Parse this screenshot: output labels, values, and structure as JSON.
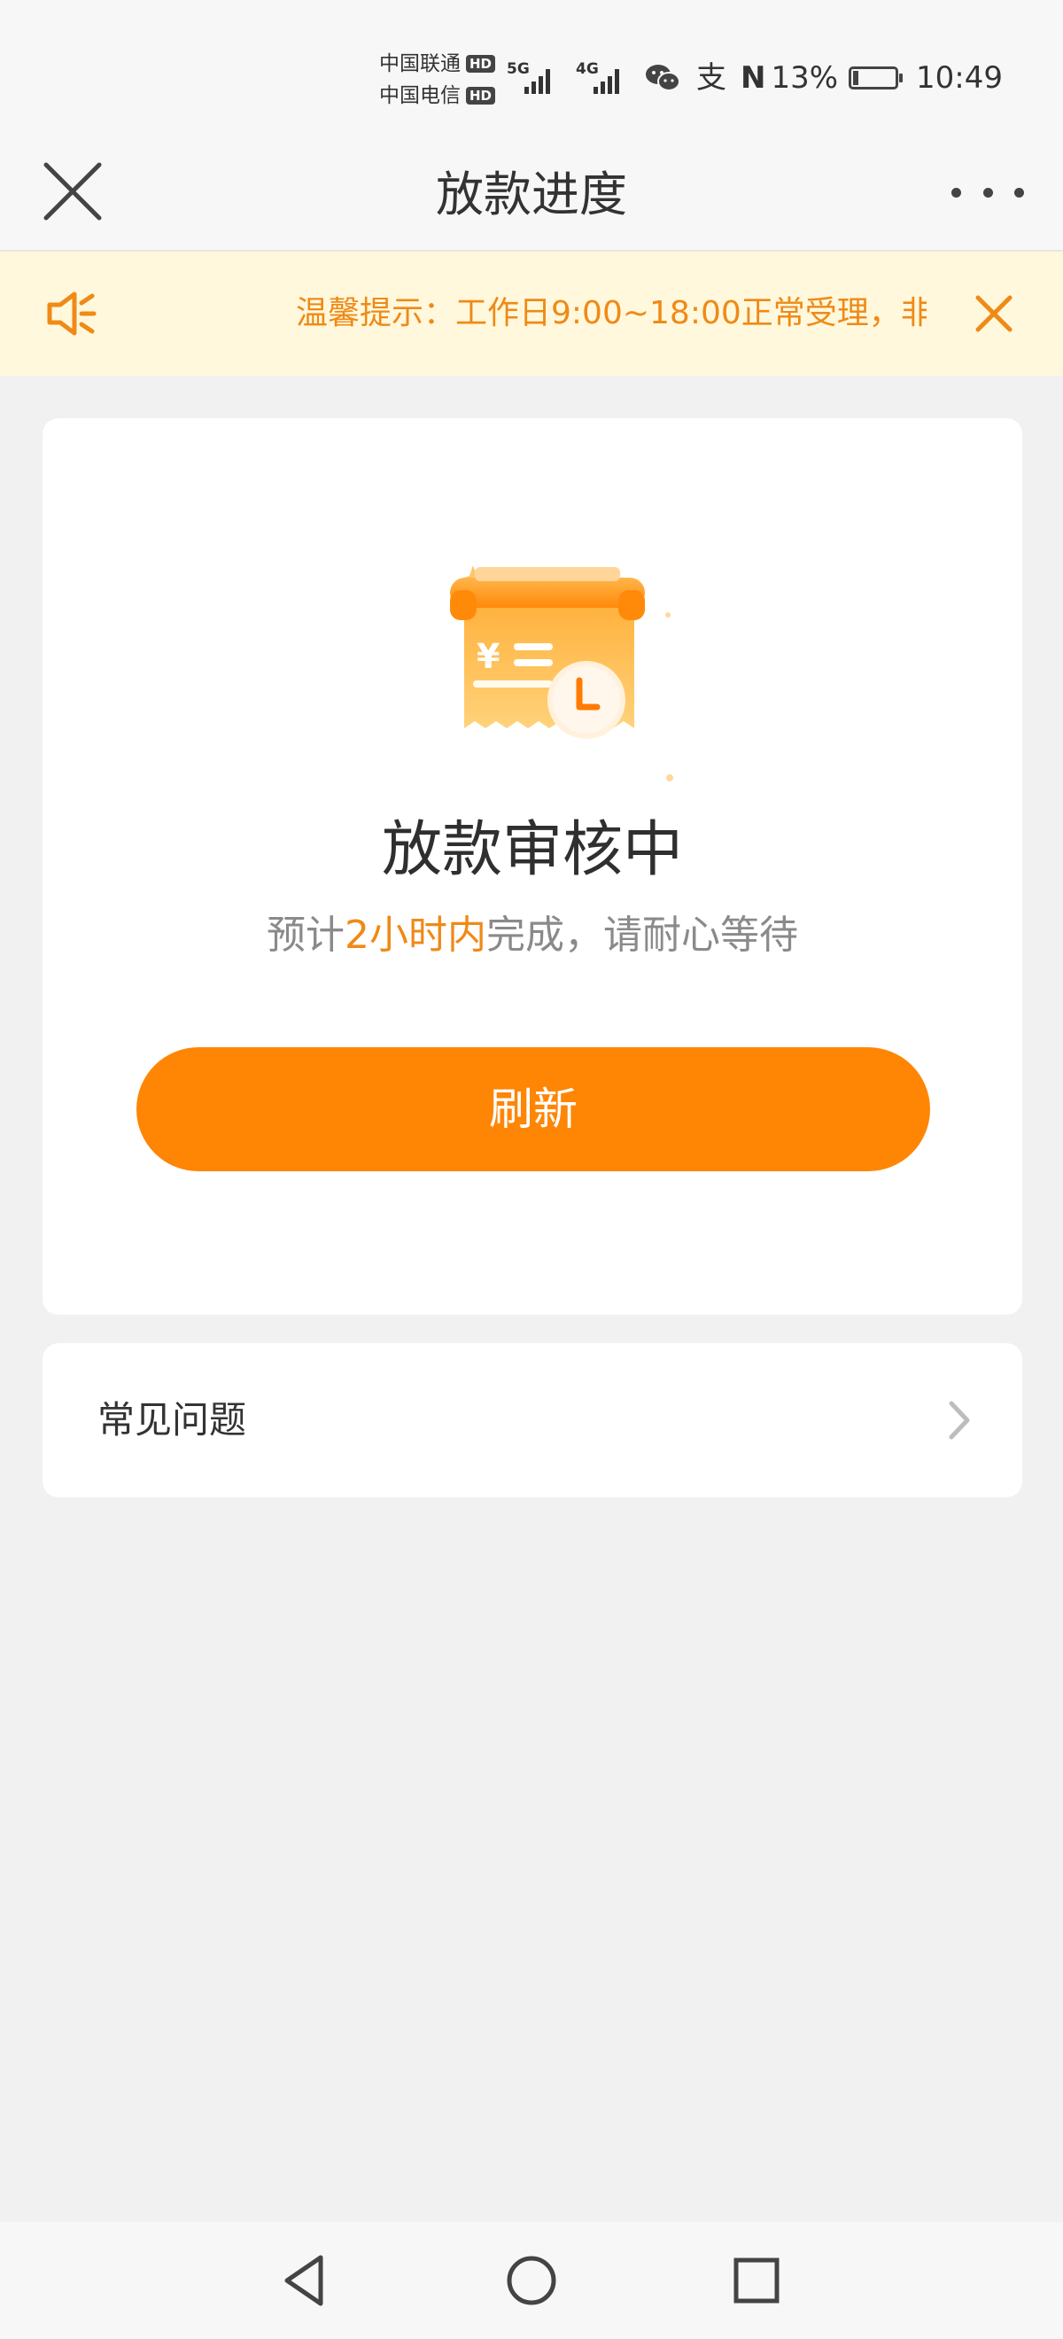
{
  "status_bar": {
    "carriers": [
      {
        "name": "中国联通",
        "badge": "HD"
      },
      {
        "name": "中国电信",
        "badge": "HD"
      }
    ],
    "signals": [
      {
        "generation": "5G",
        "icon": "signal-5g-icon"
      },
      {
        "generation": "4G",
        "icon": "signal-4g-icon"
      }
    ],
    "wechat_icon": "wechat-icon",
    "alipay_icon": "alipay-icon",
    "nfc_icon": "nfc-icon",
    "battery": {
      "percent_text": "13%",
      "level": 0.13,
      "icon": "battery-charging-icon"
    },
    "time": "10:49"
  },
  "nav": {
    "title": "放款进度",
    "close_icon": "close-icon",
    "more_icon": "more-icon"
  },
  "notice": {
    "icon": "speaker-icon",
    "text": "温馨提示：工作日9:00~18:00正常受理，非",
    "close_icon": "close-icon",
    "accent_color": "#ef8a16",
    "background": "#fff8dd"
  },
  "loan_status": {
    "illustration_icon": "receipt-clock-icon",
    "title": "放款审核中",
    "subtitle_prefix": "预计",
    "subtitle_highlight": "2小时内",
    "subtitle_suffix": "完成，请耐心等待",
    "refresh_button_label": "刷新",
    "button_color": "#ff8504"
  },
  "faq": {
    "label": "常见问题",
    "chevron_icon": "chevron-right-icon"
  },
  "system_nav": {
    "back_icon": "back-triangle-icon",
    "home_icon": "home-circle-icon",
    "recents_icon": "recents-square-icon"
  }
}
